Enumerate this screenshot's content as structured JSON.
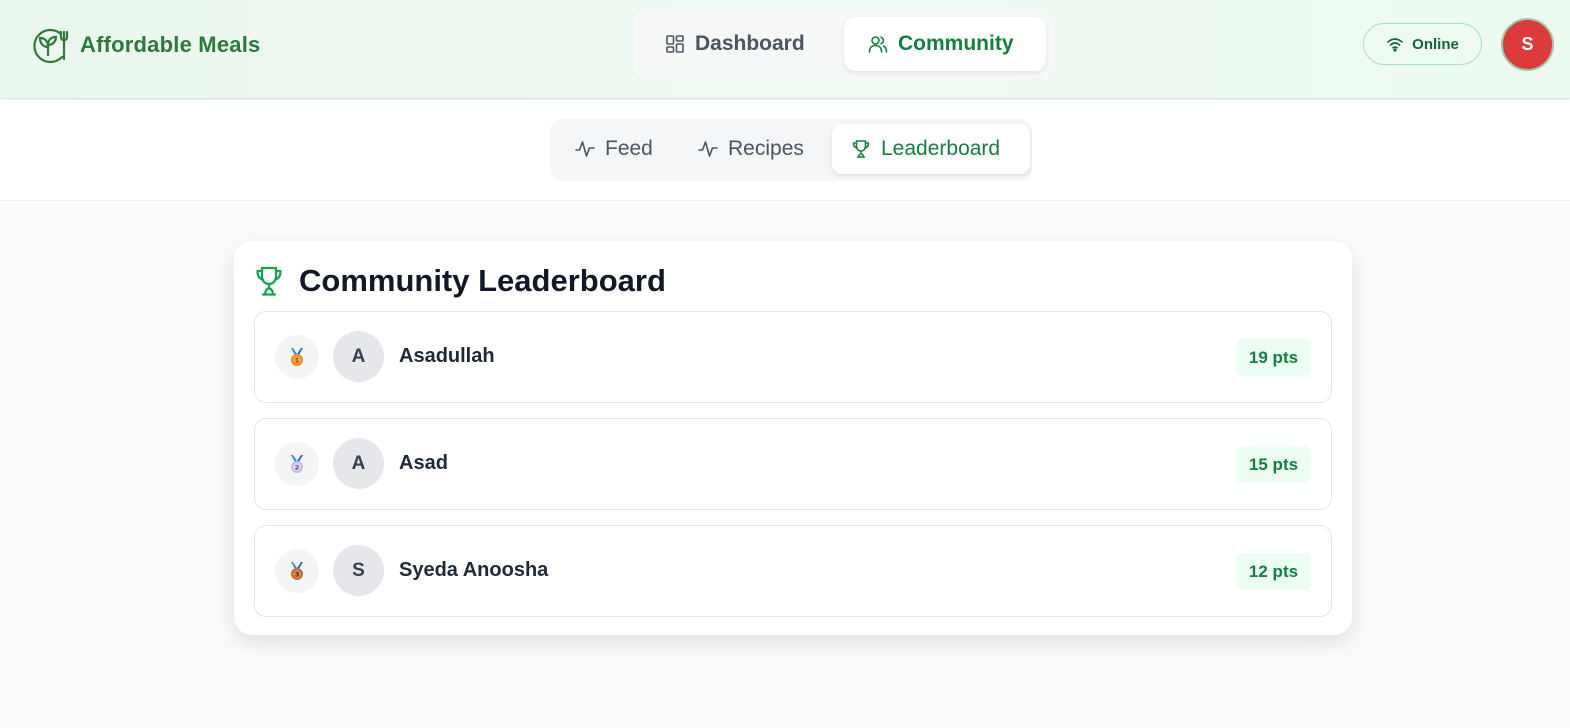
{
  "app": {
    "name": "Affordable Meals"
  },
  "main_nav": {
    "tabs": [
      {
        "label": "Dashboard",
        "icon": "dashboard-icon",
        "active": false
      },
      {
        "label": "Community",
        "icon": "users-icon",
        "active": true
      }
    ]
  },
  "status": {
    "label": "Online",
    "icon": "wifi-icon"
  },
  "user": {
    "initial": "S",
    "avatar_color": "#dc3b3b"
  },
  "sub_nav": {
    "tabs": [
      {
        "label": "Feed",
        "icon": "activity-icon",
        "active": false
      },
      {
        "label": "Recipes",
        "icon": "activity-icon",
        "active": false
      },
      {
        "label": "Leaderboard",
        "icon": "trophy-icon",
        "active": true
      }
    ]
  },
  "leaderboard": {
    "title": "Community Leaderboard",
    "entries": [
      {
        "rank": "1",
        "medal": "gold-medal-icon",
        "medal_color": "#f08a24",
        "initial": "A",
        "name": "Asadullah",
        "points": "19 pts"
      },
      {
        "rank": "2",
        "medal": "silver-medal-icon",
        "medal_color": "#c9b8e6",
        "initial": "A",
        "name": "Asad",
        "points": "15 pts"
      },
      {
        "rank": "3",
        "medal": "bronze-medal-icon",
        "medal_color": "#c46a3a",
        "initial": "S",
        "name": "Syeda Anoosha",
        "points": "12 pts"
      }
    ]
  },
  "colors": {
    "accent": "#15803d",
    "logo": "#2f7a3b",
    "badge_bg": "#ecfdf3"
  }
}
